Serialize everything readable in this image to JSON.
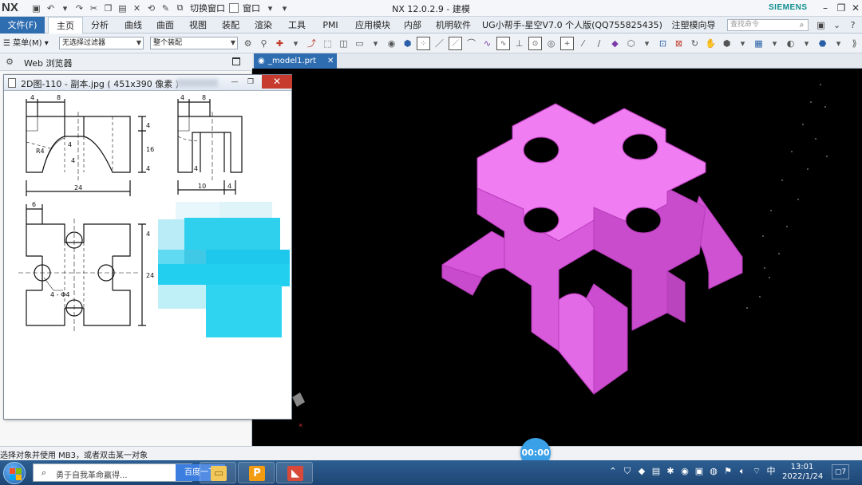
{
  "app": {
    "logo": "NX",
    "title": "NX 12.0.2.9 - 建模",
    "brand": "SIEMENS"
  },
  "quick_access": {
    "switch_window_label": "切换窗口",
    "window_label": "窗口"
  },
  "ribbon": {
    "file_tab": "文件(F)",
    "tabs": [
      {
        "label": "主页",
        "active": true
      },
      {
        "label": "分析"
      },
      {
        "label": "曲线"
      },
      {
        "label": "曲面"
      },
      {
        "label": "视图"
      },
      {
        "label": "装配"
      },
      {
        "label": "渲染"
      },
      {
        "label": "工具"
      },
      {
        "label": "PMI"
      },
      {
        "label": "应用模块"
      },
      {
        "label": "内部"
      },
      {
        "label": "机明软件"
      },
      {
        "label": "UG小帮手-星空V7.0 个人版(QQ755825435)"
      },
      {
        "label": "注塑模向导"
      }
    ],
    "search_placeholder": "查找命令"
  },
  "toolbar": {
    "menu_label": "菜单(M)",
    "filter_value": "无选择过滤器",
    "assembly_value": "整个装配"
  },
  "left_panel": {
    "title": "Web 浏览器"
  },
  "image_viewer": {
    "title": "2D图-110 - 副本.jpg ( 451x390 像素 )"
  },
  "drawing": {
    "dims": [
      "4",
      "8",
      "4",
      "8",
      "4",
      "16",
      "4",
      "4",
      "4",
      "4",
      "24",
      "10",
      "4",
      "6",
      "4",
      "24",
      "4 - Φ4",
      "R4"
    ]
  },
  "viewport": {
    "tab_label": "_model1.prt",
    "background": "#000000",
    "model_color": "#e45fe6"
  },
  "status": {
    "text": "选择对象并使用 MB3，或者双击某一对象"
  },
  "timer": "00:00",
  "taskbar": {
    "search_text": "勇于自我革命赢得...",
    "baidu_button": "百度一下",
    "clock_time": "13:01",
    "clock_date": "2022/1/24",
    "notify_count": "7"
  }
}
